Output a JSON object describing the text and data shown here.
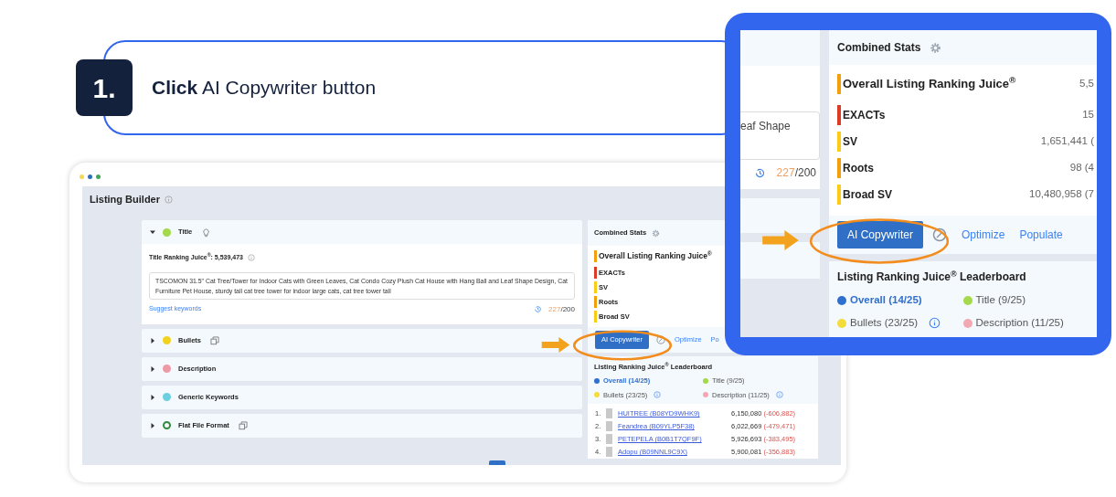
{
  "step": {
    "number": "1.",
    "instruction": "**Click** AI Copywriter button"
  },
  "screenshot": {
    "window_dots": [
      {
        "color": "#f2d94e"
      },
      {
        "color": "#2f6db5"
      },
      {
        "color": "#3fa857"
      }
    ],
    "title": "Listing Builder",
    "sections": [
      {
        "name": "Title",
        "color": "#a3d94a",
        "hollow": false,
        "kind": "bulb",
        "expanded": true
      },
      {
        "name": "Bullets",
        "color": "#f2d21f",
        "hollow": false,
        "kind": "copy",
        "expanded": false
      },
      {
        "name": "Description",
        "color": "#ee9aa6",
        "hollow": false,
        "kind": "plain",
        "expanded": false
      },
      {
        "name": "Generic Keywords",
        "color": "#6ccfe0",
        "hollow": false,
        "kind": "plain",
        "expanded": false
      },
      {
        "name": "Flat File Format",
        "color": "#2e8b3a",
        "hollow": true,
        "kind": "copy",
        "expanded": false
      }
    ],
    "title_body": {
      "juice_label": "Title Ranking Juice$^{®}$:",
      "juice_value": "5,539,473",
      "text": "TSCOMON 31.5\" Cat Tree/Tower for Indoor Cats with Green Leaves, Cat Condo Cozy Plush Cat House with Hang Ball and Leaf Shape Design, Cat Furniture Pet House, sturdy tall cat tree tower for indoor large cats, cat tree tower tall",
      "suggest_link": "Suggest keywords",
      "count": "227",
      "limit": "/200"
    },
    "combined_stats": {
      "title": "Combined Stats",
      "rows": [
        {
          "label": "Overall Listing Ranking Juice$^{®}$",
          "color": "#f59e0b",
          "kind": "main"
        },
        {
          "label": "EXACTs",
          "color": "#dc3b26",
          "kind": "sub"
        },
        {
          "label": "SV",
          "color": "#facc15",
          "kind": "sub"
        },
        {
          "label": "Roots",
          "color": "#f59e0b",
          "kind": "sub"
        },
        {
          "label": "Broad SV",
          "color": "#facc15",
          "kind": "sub"
        }
      ],
      "button": "AI Copywriter",
      "links": [
        "Optimize",
        "Po"
      ]
    },
    "leaderboard": {
      "title": "Listing Ranking Juice$^{®}$ Leaderboard",
      "legend": [
        {
          "label": "Overall (14/25)",
          "color": "#2f6fd0",
          "selected": true,
          "info": false
        },
        {
          "label": "Title (9/25)",
          "color": "#a3d94a",
          "selected": false,
          "info": false
        },
        {
          "label": "Bullets (23/25)",
          "color": "#f2dd3a",
          "selected": false,
          "info": true
        },
        {
          "label": "Description (11/25)",
          "color": "#f2a9b4",
          "selected": false,
          "info": true
        }
      ],
      "rows": [
        {
          "rank": "1.",
          "name": "HUITREE (B08YD9WHK9)",
          "score": "6,150,080",
          "change": "(-606,882)"
        },
        {
          "rank": "2.",
          "name": "Feandrea (B09YLP5F38)",
          "score": "6,022,669",
          "change": "(-479,471)"
        },
        {
          "rank": "3.",
          "name": "PETEPELA (B0B1T7QF9F)",
          "score": "5,926,693",
          "change": "(-383,495)"
        },
        {
          "rank": "4.",
          "name": "Adopu (B09NNL9C9X)",
          "score": "5,900,081",
          "change": "(-356,883)"
        }
      ]
    }
  },
  "zoom_inset": {
    "field_text": "eaf Shape",
    "count": "227",
    "limit": "/200",
    "combined_stats": {
      "title": "Combined Stats",
      "rows": [
        {
          "label": "Overall Listing Ranking Juice$^{®}$",
          "color": "#f59e0b",
          "kind": "main",
          "value": "5,5"
        },
        {
          "label": "EXACTs",
          "color": "#dc3b26",
          "kind": "sub",
          "value": "15"
        },
        {
          "label": "SV",
          "color": "#facc15",
          "kind": "sub",
          "value": "1,651,441 ("
        },
        {
          "label": "Roots",
          "color": "#f59e0b",
          "kind": "sub",
          "value": "98 (4"
        },
        {
          "label": "Broad SV",
          "color": "#facc15",
          "kind": "sub",
          "value": "10,480,958 (7"
        }
      ],
      "button": "AI Copywriter",
      "links": [
        "Optimize",
        "Populate"
      ]
    },
    "leaderboard": {
      "title": "Listing Ranking Juice$^{®}$ Leaderboard",
      "legend": [
        {
          "label": "Overall (14/25)",
          "color": "#2f6fd0",
          "selected": true,
          "info": false
        },
        {
          "label": "Title (9/25)",
          "color": "#a3d94a",
          "selected": false,
          "info": false
        },
        {
          "label": "Bullets (23/25)",
          "color": "#f2dd3a",
          "selected": false,
          "info": true
        },
        {
          "label": "Description (11/25)",
          "color": "#f2a9b4",
          "selected": false,
          "info": false
        }
      ]
    }
  }
}
